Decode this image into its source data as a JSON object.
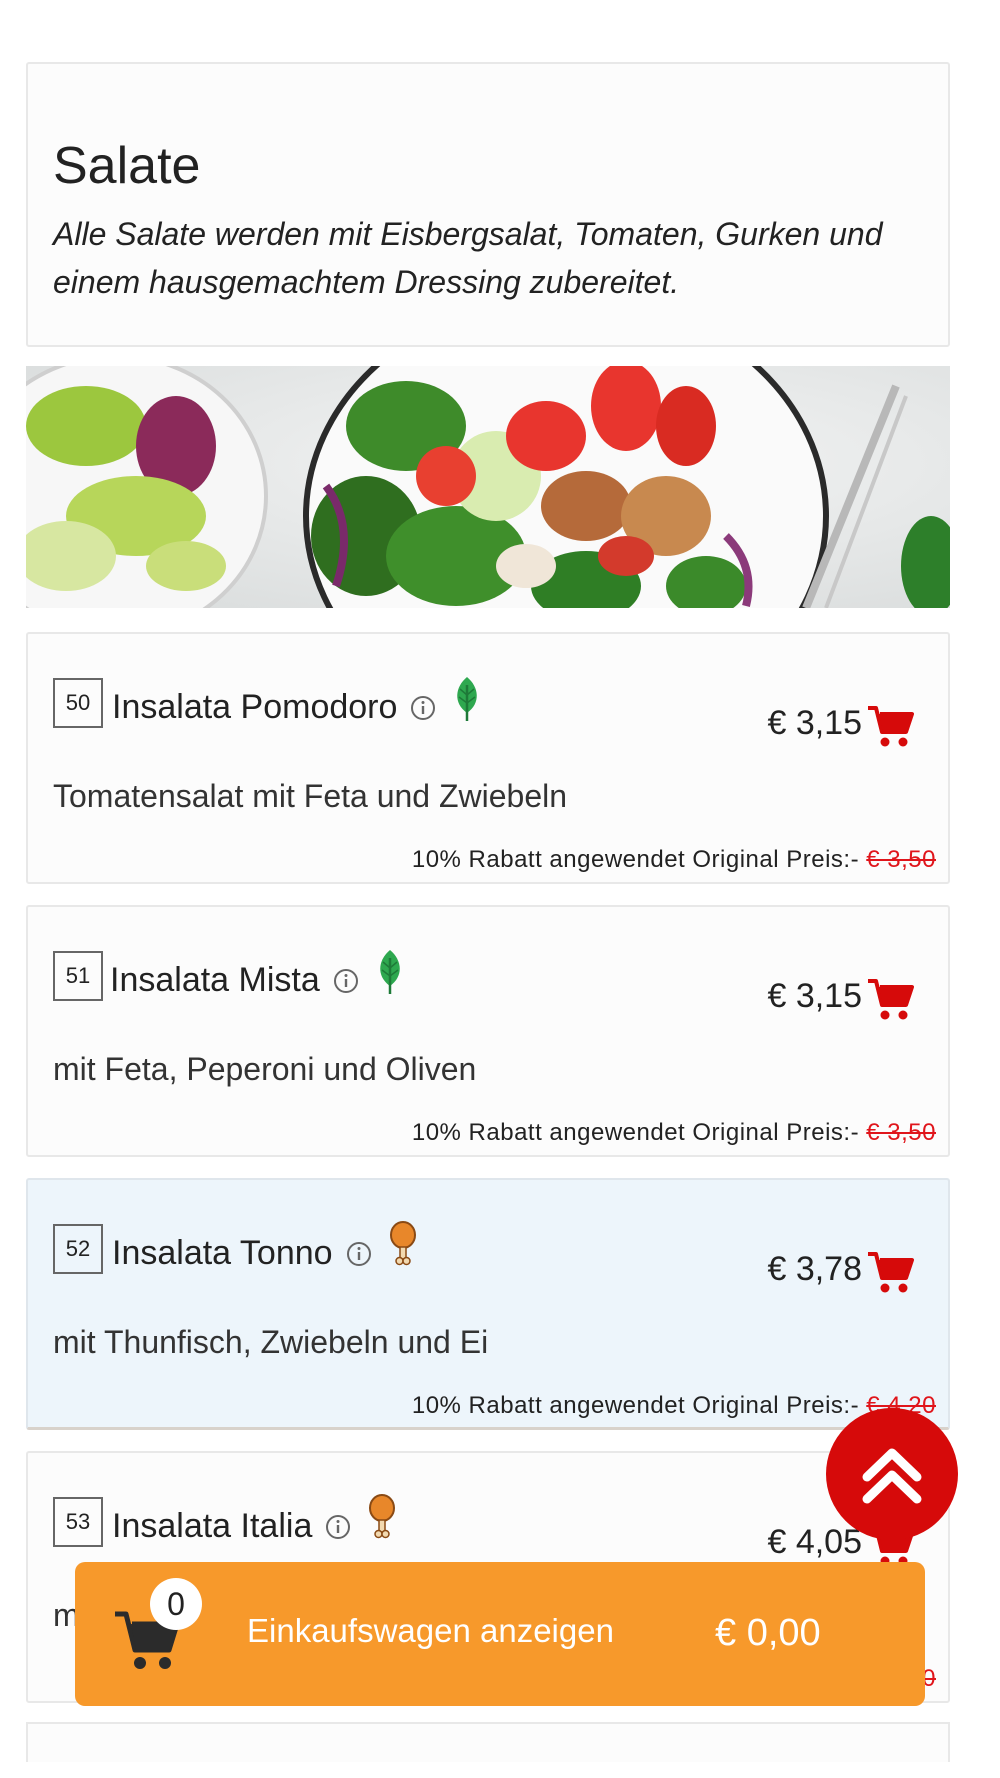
{
  "category": {
    "title": "Salate",
    "description": "Alle Salate werden mit Eisbergsalat, Tomaten, Gurken und einem hausgemachtem Dressing zubereitet."
  },
  "items": [
    {
      "number": "50",
      "name": "Insalata Pomodoro",
      "diet_icon": "leaf-icon",
      "price": "€ 3,15",
      "description": "Tomatensalat mit Feta und Zwiebeln",
      "discount_text": "10% Rabatt angewendet Original Preis:-",
      "original_price": "€ 3,50"
    },
    {
      "number": "51",
      "name": "Insalata Mista",
      "diet_icon": "leaf-icon",
      "price": "€ 3,15",
      "description": "mit Feta, Peperoni und Oliven",
      "discount_text": "10% Rabatt angewendet Original Preis:-",
      "original_price": "€ 3,50"
    },
    {
      "number": "52",
      "name": "Insalata Tonno",
      "diet_icon": "chicken-leg-icon",
      "price": "€ 3,78",
      "description": "mit Thunfisch, Zwiebeln und Ei",
      "discount_text": "10% Rabatt angewendet Original Preis:-",
      "original_price": "€ 4,20"
    },
    {
      "number": "53",
      "name": "Insalata Italia",
      "diet_icon": "chicken-leg-icon",
      "price": "€ 4,05",
      "description": "m",
      "discount_text": "",
      "original_price": "€ 4,50"
    }
  ],
  "cart": {
    "count": "0",
    "label": "Einkaufswagen anzeigen",
    "total": "€ 0,00"
  },
  "colors": {
    "accent_red": "#d60a0a",
    "cart_orange": "#f7992b",
    "leaf_green": "#2ea84f",
    "chicken_orange": "#e8872a"
  }
}
